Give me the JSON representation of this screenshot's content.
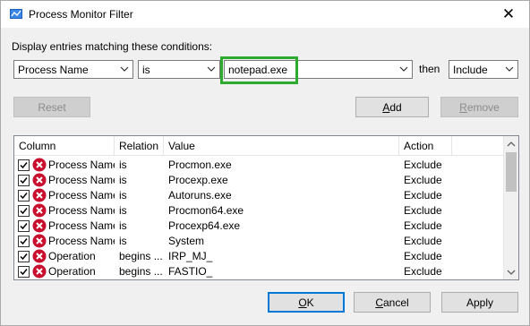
{
  "window": {
    "title": "Process Monitor Filter",
    "close_glyph": "✕"
  },
  "prompt": "Display entries matching these conditions:",
  "filter": {
    "column": "Process Name",
    "relation": "is",
    "value": "notepad.exe",
    "then_label": "then",
    "action": "Include"
  },
  "buttons": {
    "reset": "Reset",
    "add_prefix": "",
    "add_accel": "A",
    "add_rest": "dd",
    "remove_prefix": "",
    "remove_accel": "R",
    "remove_rest": "emove",
    "ok_prefix": "",
    "ok_accel": "O",
    "ok_rest": "K",
    "cancel_prefix": "",
    "cancel_accel": "C",
    "cancel_rest": "ancel",
    "apply": "Apply"
  },
  "table": {
    "headers": [
      "Column",
      "Relation",
      "Value",
      "Action"
    ],
    "rows": [
      {
        "column": "Process Name",
        "relation": "is",
        "value": "Procmon.exe",
        "action": "Exclude"
      },
      {
        "column": "Process Name",
        "relation": "is",
        "value": "Procexp.exe",
        "action": "Exclude"
      },
      {
        "column": "Process Name",
        "relation": "is",
        "value": "Autoruns.exe",
        "action": "Exclude"
      },
      {
        "column": "Process Name",
        "relation": "is",
        "value": "Procmon64.exe",
        "action": "Exclude"
      },
      {
        "column": "Process Name",
        "relation": "is",
        "value": "Procexp64.exe",
        "action": "Exclude"
      },
      {
        "column": "Process Name",
        "relation": "is",
        "value": "System",
        "action": "Exclude"
      },
      {
        "column": "Operation",
        "relation": "begins ...",
        "value": "IRP_MJ_",
        "action": "Exclude"
      },
      {
        "column": "Operation",
        "relation": "begins ...",
        "value": "FASTIO_",
        "action": "Exclude"
      }
    ]
  },
  "colors": {
    "highlight": "#2eaa2e",
    "exclude_icon": "#c8102e",
    "focus": "#0078d7"
  }
}
